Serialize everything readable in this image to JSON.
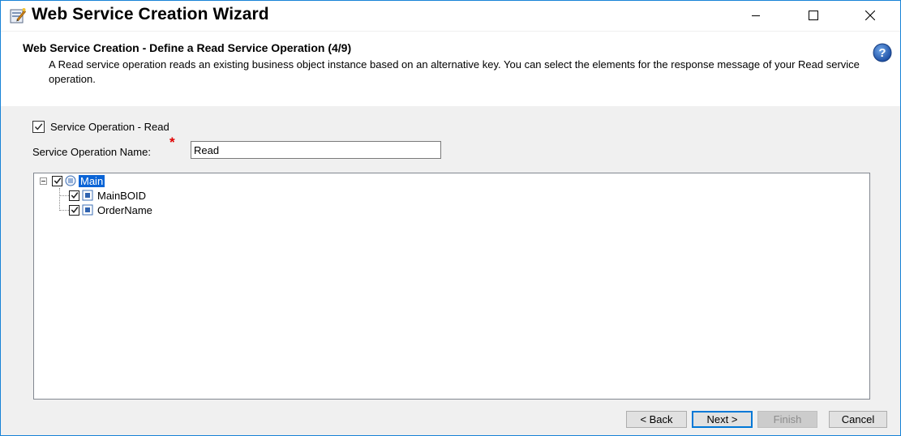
{
  "window": {
    "title": "Web Service Creation Wizard",
    "controls": [
      "minimize-icon",
      "maximize-icon",
      "close-icon"
    ]
  },
  "banner": {
    "title": "Web Service Creation - Define a Read Service Operation (4/9)",
    "description": "A Read service operation reads an existing business object instance based on an alternative key. You can select the elements for the response message of your Read service operation.",
    "help_icon": "help-icon"
  },
  "form": {
    "operation_checkbox_label": "Service Operation - Read",
    "operation_checked": true,
    "name_label": "Service Operation Name:",
    "required_marker": "*",
    "name_value": "Read"
  },
  "tree": {
    "root": {
      "label": "Main",
      "checked": true,
      "selected": true,
      "expanded": true,
      "icon": "structure-node-icon"
    },
    "children": [
      {
        "label": "MainBOID",
        "checked": true,
        "icon": "element-node-icon"
      },
      {
        "label": "OrderName",
        "checked": true,
        "icon": "element-node-icon"
      }
    ]
  },
  "buttons": {
    "back": "< Back",
    "next": "Next >",
    "finish": "Finish",
    "cancel": "Cancel"
  },
  "colors": {
    "window_border": "#1883d7",
    "selection": "#0a64d6",
    "required": "#e00000",
    "default_button_border": "#0078d7"
  }
}
